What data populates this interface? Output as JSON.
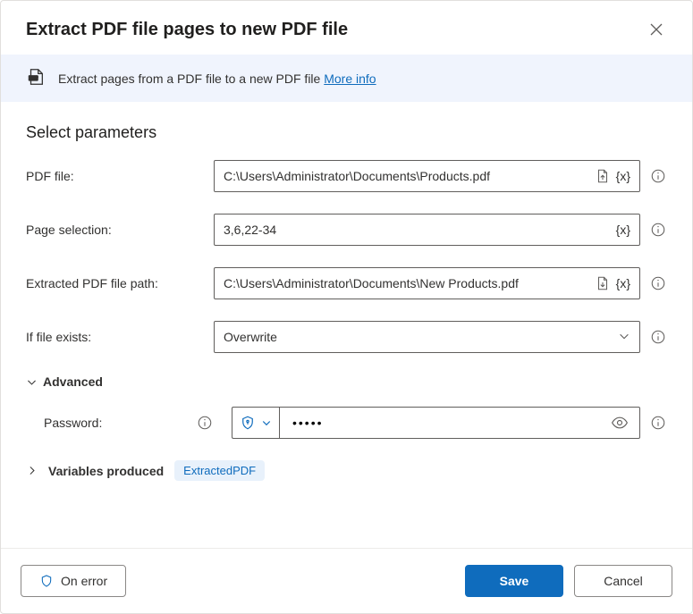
{
  "dialog": {
    "title": "Extract PDF file pages to new PDF file"
  },
  "banner": {
    "text": "Extract pages from a PDF file to a new PDF file ",
    "link": "More info"
  },
  "section_title": "Select parameters",
  "fields": {
    "pdf_file": {
      "label": "PDF file:",
      "value": "C:\\Users\\Administrator\\Documents\\Products.pdf"
    },
    "page_selection": {
      "label": "Page selection:",
      "value": "3,6,22-34"
    },
    "extracted_path": {
      "label": "Extracted PDF file path:",
      "value": "C:\\Users\\Administrator\\Documents\\New Products.pdf"
    },
    "if_exists": {
      "label": "If file exists:",
      "value": "Overwrite"
    }
  },
  "advanced": {
    "label": "Advanced",
    "password": {
      "label": "Password:",
      "value": "•••••"
    }
  },
  "variables": {
    "label": "Variables produced",
    "badge": "ExtractedPDF"
  },
  "footer": {
    "on_error": "On error",
    "save": "Save",
    "cancel": "Cancel"
  },
  "tokens": {
    "var": "{x}"
  }
}
